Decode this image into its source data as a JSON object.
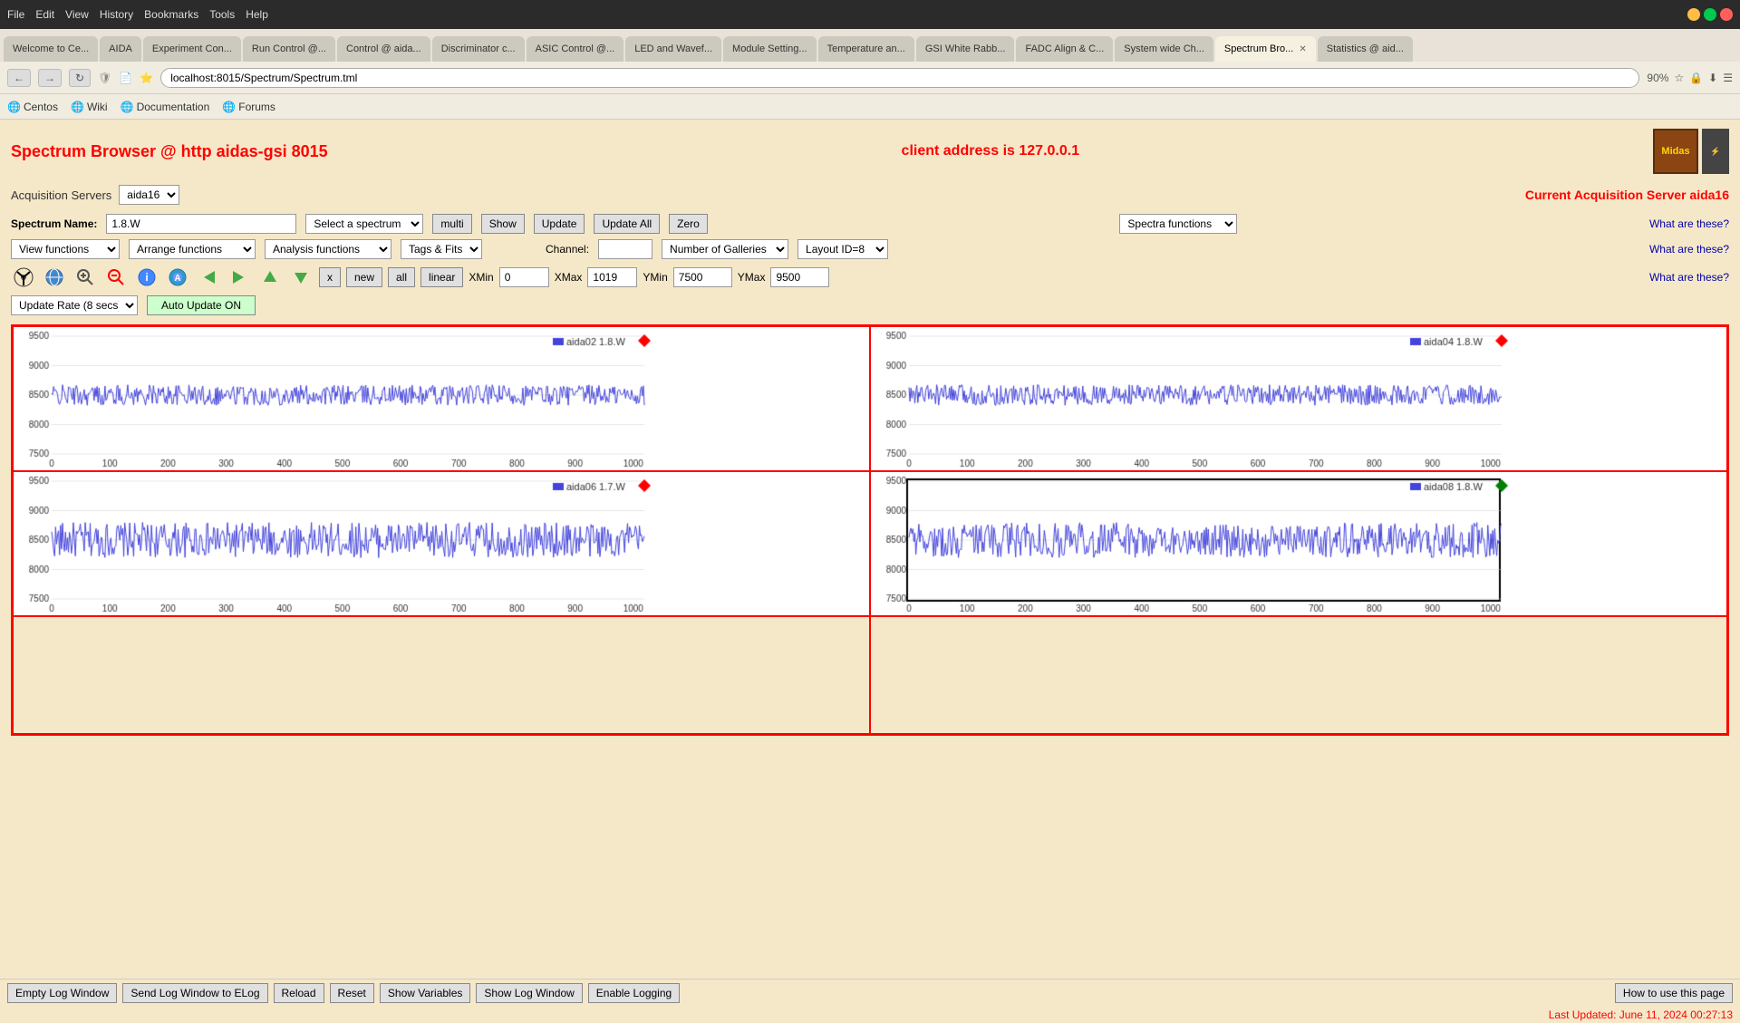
{
  "browser": {
    "menu_items": [
      "File",
      "Edit",
      "View",
      "History",
      "Bookmarks",
      "Tools",
      "Help"
    ],
    "tabs": [
      {
        "label": "Welcome to Ce...",
        "active": false
      },
      {
        "label": "AIDA",
        "active": false
      },
      {
        "label": "Experiment Con...",
        "active": false
      },
      {
        "label": "Run Control @...",
        "active": false
      },
      {
        "label": "Control @ aida...",
        "active": false
      },
      {
        "label": "Discriminator c...",
        "active": false
      },
      {
        "label": "ASIC Control @...",
        "active": false
      },
      {
        "label": "LED and Wavef...",
        "active": false
      },
      {
        "label": "Module Setting...",
        "active": false
      },
      {
        "label": "Temperature an...",
        "active": false
      },
      {
        "label": "GSI White Rabb...",
        "active": false
      },
      {
        "label": "FADC Align & C...",
        "active": false
      },
      {
        "label": "System wide Ch...",
        "active": false
      },
      {
        "label": "Spectrum Bro...",
        "active": true,
        "closable": true
      },
      {
        "label": "Statistics @ aid...",
        "active": false
      }
    ],
    "url": "localhost:8015/Spectrum/Spectrum.tml",
    "zoom": "90%",
    "bookmarks": [
      "Centos",
      "Wiki",
      "Documentation",
      "Forums"
    ]
  },
  "page": {
    "title": "Spectrum Browser @ http aidas-gsi 8015",
    "client_address": "client address is 127.0.0.1",
    "logo_text": "Midas",
    "acquisition_servers_label": "Acquisition Servers",
    "acquisition_server_value": "aida16",
    "current_acq_label": "Current Acquisition Server aida16",
    "spectrum_name_label": "Spectrum Name:",
    "spectrum_name_value": "1.8.W",
    "select_spectrum_label": "Select a spectrum",
    "multi_btn": "multi",
    "show_btn": "Show",
    "update_btn": "Update",
    "update_all_btn": "Update All",
    "zero_btn": "Zero",
    "spectra_functions": "Spectra functions",
    "what_are_these_1": "What are these?",
    "view_functions": "View functions",
    "arrange_functions": "Arrange functions",
    "analysis_functions": "Analysis functions",
    "tags_fits": "Tags & Fits",
    "channel_label": "Channel:",
    "channel_value": "",
    "number_of_galleries": "Number of Galleries",
    "layout_id": "Layout ID=8",
    "what_are_these_2": "What are these?",
    "x_btn": "x",
    "new_btn": "new",
    "all_btn": "all",
    "linear_btn": "linear",
    "xmin_label": "XMin",
    "xmin_value": "0",
    "xmax_label": "XMax",
    "xmax_value": "1019",
    "ymin_label": "YMin",
    "ymin_value": "7500",
    "ymax_label": "YMax",
    "ymax_value": "9500",
    "what_are_these_3": "What are these?",
    "update_rate": "Update Rate (8 secs)",
    "auto_update": "Auto Update ON",
    "charts": [
      {
        "id": "chart1",
        "label": "aida02 1.8.W",
        "ymin": 7500,
        "ymax": 9500,
        "xmin": 0,
        "xmax": 1019,
        "marker_color": "red"
      },
      {
        "id": "chart2",
        "label": "aida04 1.8.W",
        "ymin": 7500,
        "ymax": 9500,
        "xmin": 0,
        "xmax": 1019,
        "marker_color": "red"
      },
      {
        "id": "chart3",
        "label": "aida06 1.7.W",
        "ymin": 7500,
        "ymax": 9500,
        "xmin": 0,
        "xmax": 1019,
        "marker_color": "red"
      },
      {
        "id": "chart4",
        "label": "aida08 1.8.W",
        "ymin": 7500,
        "ymax": 9500,
        "xmin": 0,
        "xmax": 1019,
        "marker_color": "green"
      }
    ],
    "bottom_buttons": [
      "Empty Log Window",
      "Send Log Window to ELog",
      "Reload",
      "Reset",
      "Show Variables",
      "Show Log Window",
      "Enable Logging"
    ],
    "how_to_use": "How to use this page",
    "last_updated": "Last Updated: June 11, 2024 00:27:13"
  }
}
